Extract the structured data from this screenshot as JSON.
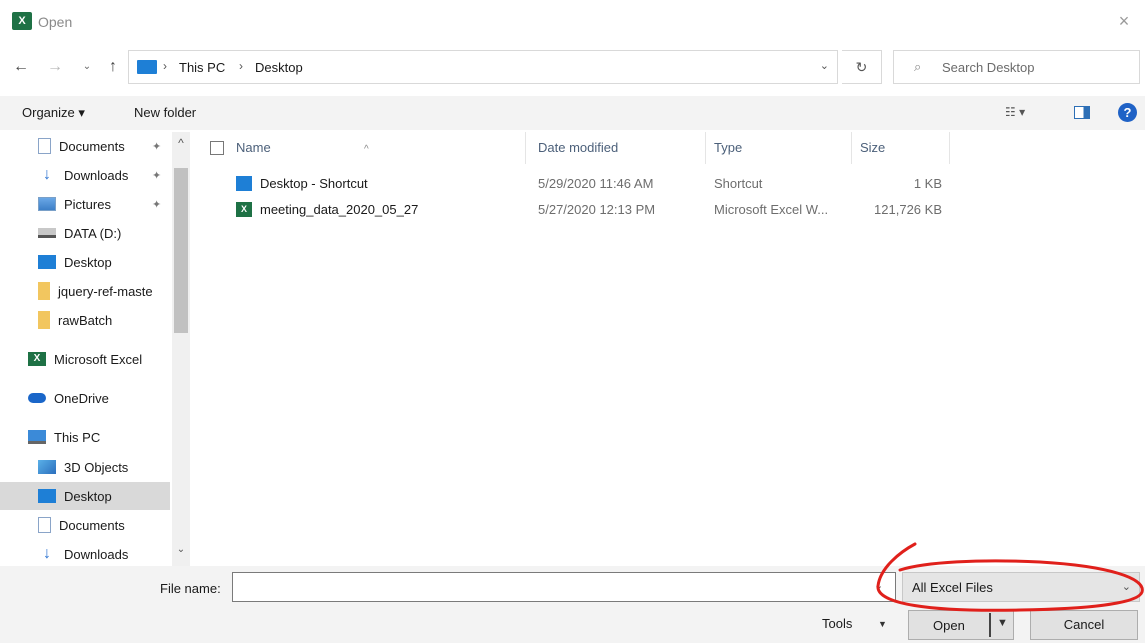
{
  "window": {
    "title": "Open",
    "app_icon_text": "X",
    "close_glyph": "×"
  },
  "navigation": {
    "back_glyph": "←",
    "forward_glyph": "→",
    "recent_glyph": "⌄",
    "up_glyph": "↑",
    "breadcrumbs": [
      "This PC",
      "Desktop"
    ],
    "separator_glyph": "›",
    "dropdown_glyph": "⌄",
    "refresh_glyph": "↻"
  },
  "search": {
    "icon_glyph": "⌕",
    "placeholder": "Search Desktop"
  },
  "toolbar": {
    "organize_label": "Organize ▾",
    "new_folder_label": "New folder",
    "view_glyph": "☷ ▾",
    "help_glyph": "?"
  },
  "nav_pane": {
    "items": [
      {
        "label": "Documents",
        "icon": "documents-icon",
        "pinned": true
      },
      {
        "label": "Downloads",
        "icon": "downloads-icon",
        "pinned": true
      },
      {
        "label": "Pictures",
        "icon": "pictures-icon",
        "pinned": true
      },
      {
        "label": "DATA (D:)",
        "icon": "drive-icon",
        "pinned": false
      },
      {
        "label": "Desktop",
        "icon": "desktop-icon",
        "pinned": false
      },
      {
        "label": "jquery-ref-maste",
        "icon": "folder-icon",
        "pinned": false
      },
      {
        "label": "rawBatch",
        "icon": "folder-icon",
        "pinned": false
      },
      {
        "label": "Microsoft Excel",
        "icon": "excel-icon",
        "pinned": false
      },
      {
        "label": "OneDrive",
        "icon": "onedrive-icon",
        "pinned": false
      },
      {
        "label": "This PC",
        "icon": "this-pc-icon",
        "pinned": false
      },
      {
        "label": "3D Objects",
        "icon": "3d-objects-icon",
        "pinned": false
      },
      {
        "label": "Desktop",
        "icon": "desktop-icon",
        "pinned": false,
        "selected": true
      },
      {
        "label": "Documents",
        "icon": "documents-icon",
        "pinned": false
      },
      {
        "label": "Downloads",
        "icon": "downloads-icon",
        "pinned": false
      }
    ],
    "pin_glyph": "✦",
    "scroll_up_glyph": "^",
    "scroll_down_glyph": "⌄"
  },
  "file_list": {
    "columns": [
      "Name",
      "Date modified",
      "Type",
      "Size"
    ],
    "sort_glyph": "^",
    "rows": [
      {
        "name": "Desktop - Shortcut",
        "date": "5/29/2020 11:46 AM",
        "type": "Shortcut",
        "size": "1 KB",
        "icon": "shortcut-icon"
      },
      {
        "name": "meeting_data_2020_05_27",
        "date": "5/27/2020 12:13 PM",
        "type": "Microsoft Excel W...",
        "size": "121,726 KB",
        "icon": "excel-file-icon"
      }
    ]
  },
  "bottom": {
    "file_name_label": "File name:",
    "file_name_value": "",
    "file_name_drop_glyph": "⌄",
    "filter_value": "All Excel Files",
    "filter_drop_glyph": "⌄",
    "tools_label": "Tools",
    "tools_drop_glyph": "▼",
    "open_label": "Open",
    "open_drop_glyph": "▼",
    "cancel_label": "Cancel"
  },
  "colors": {
    "annotation": "#e0201b",
    "accent": "#1e7fd6",
    "excel_green": "#1e7145"
  }
}
